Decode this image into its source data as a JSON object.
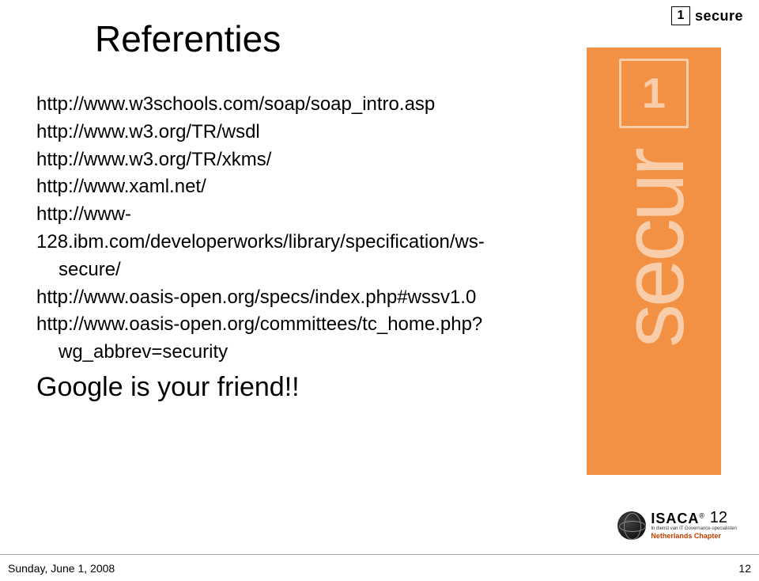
{
  "slide": {
    "title": "Referenties",
    "references": [
      {
        "line": "http://www.w3schools.com/soap/soap_intro.asp"
      },
      {
        "line": "http://www.w3.org/TR/wsdl"
      },
      {
        "line": "http://www.w3.org/TR/xkms/"
      },
      {
        "line": "http://www.xaml.net/"
      },
      {
        "line": "http://www-128.ibm.com/developerworks/library/specification/ws-",
        "cont": "secure/"
      },
      {
        "line": "http://www.oasis-open.org/specs/index.php#wssv1.0"
      },
      {
        "line": "http://www.oasis-open.org/committees/tc_home.php?",
        "cont": "wg_abbrev=security"
      }
    ],
    "closing": "Google is your friend!!",
    "page_number": "12"
  },
  "branding": {
    "secure_icon_glyph": "1",
    "secure_text": "secure",
    "watermark_glyph": "1",
    "watermark_text": "secur"
  },
  "isaca": {
    "name": "ISACA",
    "reg": "®",
    "tagline": "In dienst van IT Governance-specialisten",
    "chapter": "Netherlands Chapter"
  },
  "footer": {
    "date": "Sunday, June 1, 2008",
    "page": "12"
  }
}
